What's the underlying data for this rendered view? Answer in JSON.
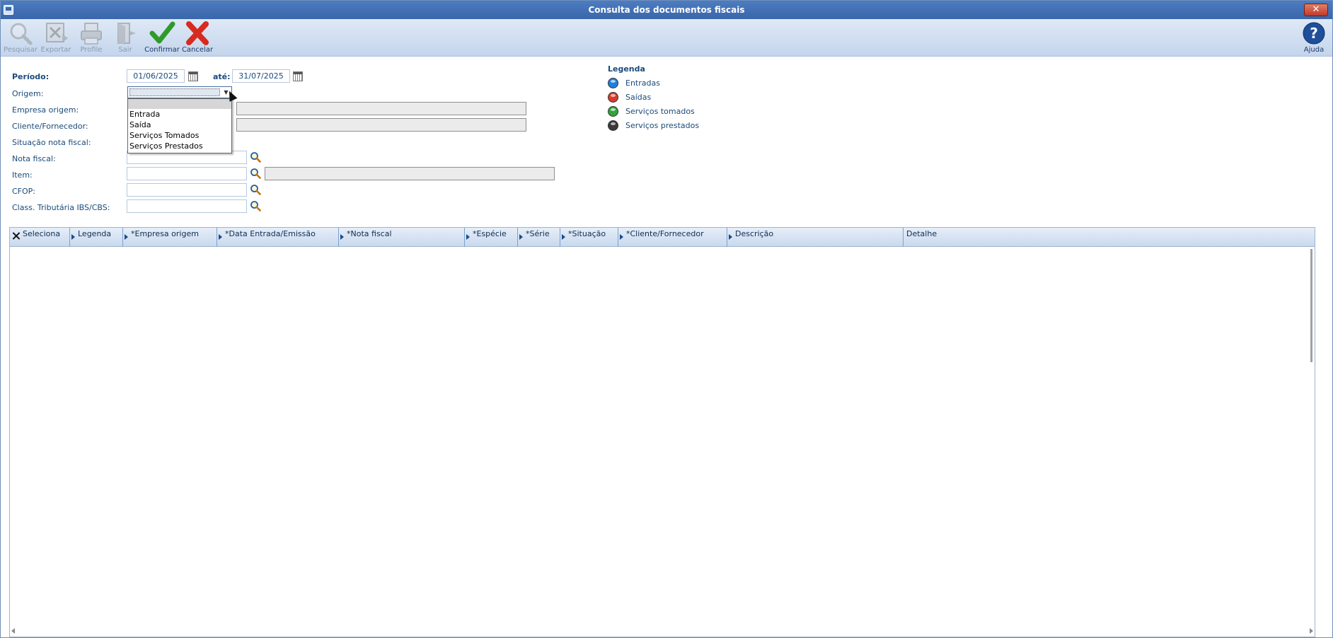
{
  "window": {
    "title": "Consulta dos documentos fiscais",
    "close_label": "✕"
  },
  "toolbar": {
    "buttons": [
      {
        "label": "Pesquisar",
        "icon": "search-icon",
        "enabled": false
      },
      {
        "label": "Exportar",
        "icon": "export-icon",
        "enabled": false
      },
      {
        "label": "Profile",
        "icon": "profile-icon",
        "enabled": false
      },
      {
        "label": "Sair",
        "icon": "exit-icon",
        "enabled": false
      },
      {
        "label": "Confirmar",
        "icon": "check-icon",
        "enabled": true
      },
      {
        "label": "Cancelar",
        "icon": "cancel-icon",
        "enabled": true
      }
    ],
    "help_label": "Ajuda"
  },
  "form": {
    "periodo_label": "Período:",
    "periodo_from": "01/06/2025",
    "ate_label": "até:",
    "periodo_to": "31/07/2025",
    "origem_label": "Origem:",
    "empresa_label": "Empresa origem:",
    "cliente_label": "Cliente/Fornecedor:",
    "situacao_label": "Situação nota fiscal:",
    "nota_label": "Nota fiscal:",
    "item_label": "Item:",
    "cfop_label": "CFOP:",
    "class_label": "Class. Tributária IBS/CBS:"
  },
  "origem_dropdown": {
    "options": [
      "",
      "Entrada",
      "Saída",
      "Serviços Tomados",
      "Serviços Prestados"
    ]
  },
  "legend": {
    "title": "Legenda",
    "items": [
      {
        "label": "Entradas",
        "color": "#1e7fe0"
      },
      {
        "label": "Saídas",
        "color": "#d83a2a"
      },
      {
        "label": "Serviços tomados",
        "color": "#2fa53a"
      },
      {
        "label": "Serviços prestados",
        "color": "#3a3a3a"
      }
    ]
  },
  "grid": {
    "columns": [
      "Seleciona",
      "Legenda",
      "*Empresa origem",
      "*Data Entrada/Emissão",
      "*Nota fiscal",
      "*Espécie",
      "*Série",
      "*Situação",
      "*Cliente/Fornecedor",
      "Descrição",
      "Detalhe"
    ]
  }
}
